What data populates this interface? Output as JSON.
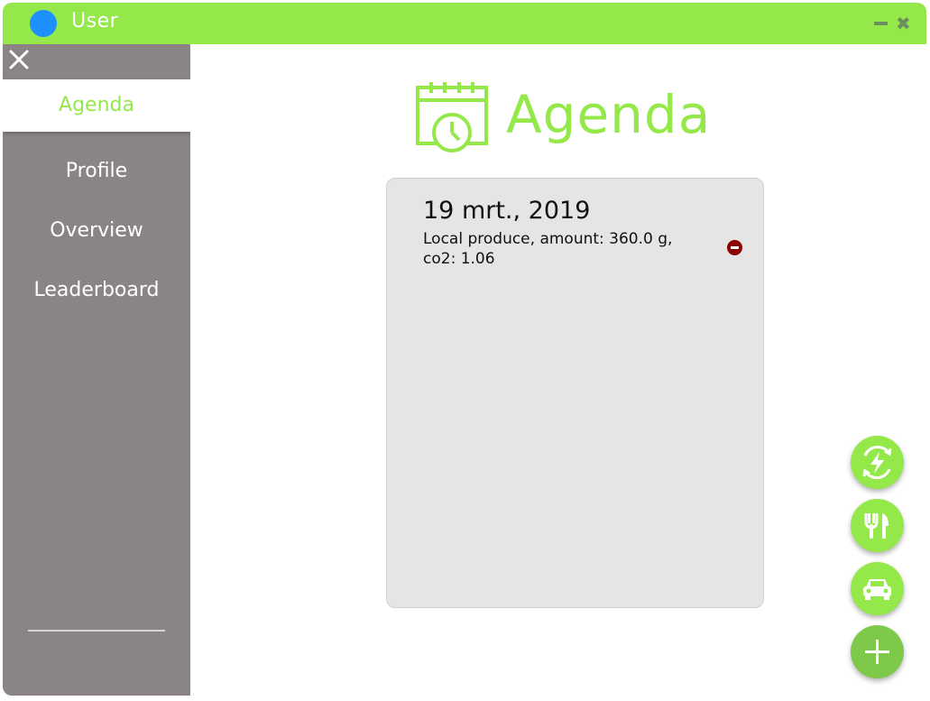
{
  "window": {
    "title": "User"
  },
  "sidebar": {
    "items": [
      {
        "label": "Agenda",
        "active": true
      },
      {
        "label": "Profile",
        "active": false
      },
      {
        "label": "Overview",
        "active": false
      },
      {
        "label": "Leaderboard",
        "active": false
      }
    ]
  },
  "main": {
    "title": "Agenda",
    "entries": [
      {
        "date": "19 mrt., 2019",
        "description": "Local produce, amount: 360.0 g, co2: 1.06"
      }
    ]
  },
  "actions": [
    {
      "icon": "energy-icon"
    },
    {
      "icon": "food-icon"
    },
    {
      "icon": "car-icon"
    },
    {
      "icon": "plus-icon"
    }
  ],
  "colors": {
    "accent": "#94e84a",
    "sidebar": "#8b8484",
    "card": "#e5e5e5",
    "remove": "#8b0000",
    "app_dot": "#1e90ff"
  }
}
